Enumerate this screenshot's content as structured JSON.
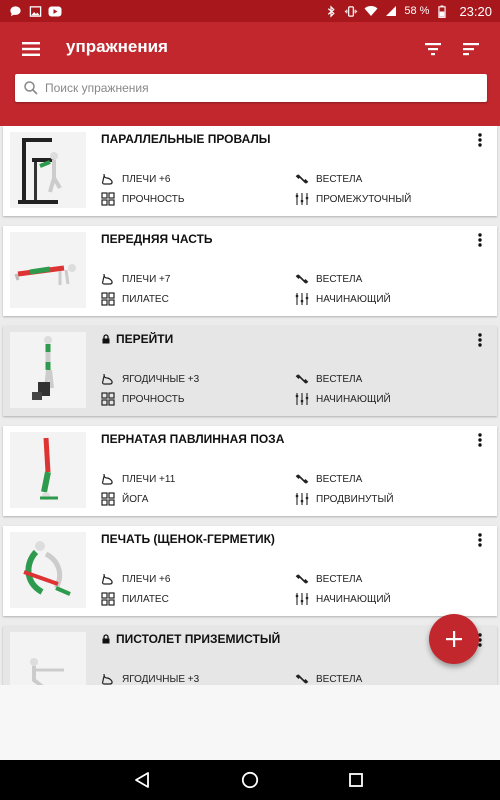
{
  "status_bar": {
    "icons_left": [
      "chat-icon",
      "image-icon",
      "youtube-icon"
    ],
    "icons_right": [
      "bluetooth-icon",
      "vibrate-icon",
      "wifi-icon",
      "cellular-icon",
      "battery-icon"
    ],
    "battery": "58 %",
    "time": "23:20"
  },
  "app_bar": {
    "title": "упражнения",
    "search_placeholder": "Поиск упражнения",
    "search_value": ""
  },
  "colors": {
    "primary": "#c1272d",
    "status_bar": "#a8171c",
    "locked_card": "#e6e6e6"
  },
  "exercises": [
    {
      "title": "ПАРАЛЛЕЛЬНЫЕ ПРОВАЛЫ",
      "locked": false,
      "muscle": "ПЛЕЧИ +6",
      "equipment": "ВЕСТЕЛА",
      "type": "ПРОЧНОСТЬ",
      "level": "ПРОМЕЖУТОЧНЫЙ"
    },
    {
      "title": "ПЕРЕДНЯЯ ЧАСТЬ",
      "locked": false,
      "muscle": "ПЛЕЧИ +7",
      "equipment": "ВЕСТЕЛА",
      "type": "ПИЛАТЕС",
      "level": "НАЧИНАЮЩИЙ"
    },
    {
      "title": "ПЕРЕЙТИ",
      "locked": true,
      "muscle": "ЯГОДИЧНЫЕ +3",
      "equipment": "ВЕСТЕЛА",
      "type": "ПРОЧНОСТЬ",
      "level": "НАЧИНАЮЩИЙ"
    },
    {
      "title": "ПЕРНАТАЯ ПАВЛИННАЯ ПОЗА",
      "locked": false,
      "muscle": "ПЛЕЧИ +11",
      "equipment": "ВЕСТЕЛА",
      "type": "ЙОГА",
      "level": "ПРОДВИНУТЫЙ"
    },
    {
      "title": "ПЕЧАТЬ (ЩЕНОК-ГЕРМЕТИК)",
      "locked": false,
      "muscle": "ПЛЕЧИ +6",
      "equipment": "ВЕСТЕЛА",
      "type": "ПИЛАТЕС",
      "level": "НАЧИНАЮЩИЙ"
    },
    {
      "title": "ПИСТОЛЕТ ПРИЗЕМИСТЫЙ",
      "locked": true,
      "muscle": "ЯГОДИЧНЫЕ +3",
      "equipment": "ВЕСТЕЛА",
      "type": "",
      "level": ""
    }
  ]
}
